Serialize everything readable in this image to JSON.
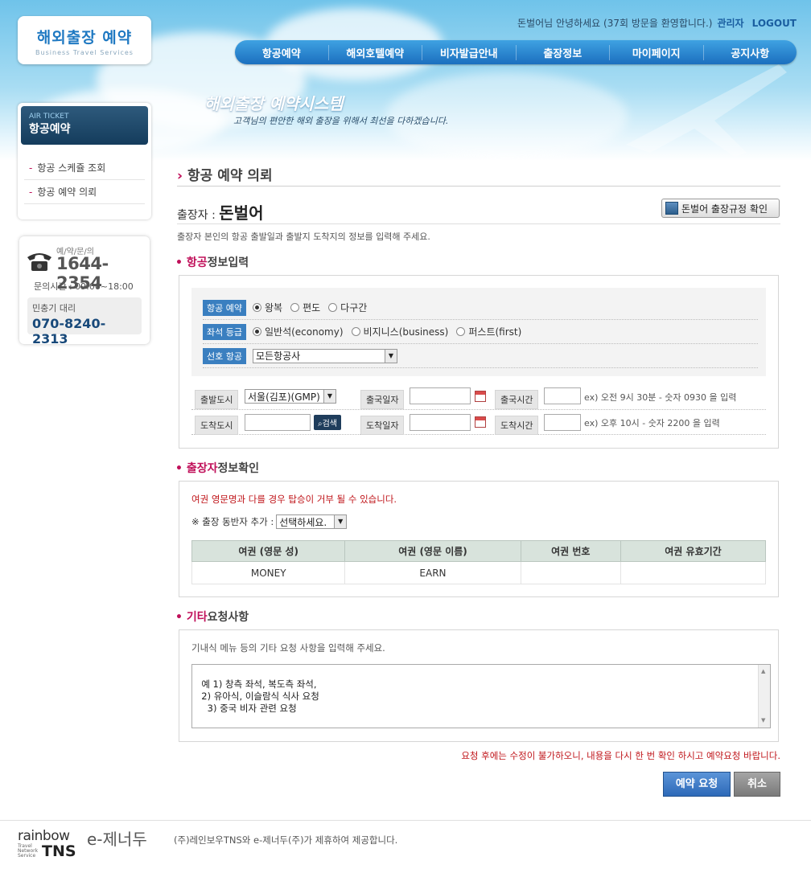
{
  "header": {
    "logo_title": "해외출장 예약",
    "logo_sub": "Business Travel Services",
    "greeting": "돈벌어님 안녕하세요 (37회 방문을 환영합니다.)",
    "admin_link": "관리자",
    "logout_link": "LOGOUT",
    "nav": [
      "항공예약",
      "해외호텔예약",
      "비자발급안내",
      "출장정보",
      "마이페이지",
      "공지사항"
    ],
    "hero_title": "해외출장 예약시스템",
    "hero_sub": "고객님의 편안한 해외 출장을 위해서 최선을 다하겠습니다."
  },
  "sidebar": {
    "head_en": "AIR TICKET",
    "head_ko": "항공예약",
    "items": [
      "항공 스케쥴 조회",
      "항공 예약 의뢰"
    ]
  },
  "contact": {
    "label": "예/약/문/의",
    "phone": "1644-2354",
    "hours": "문의시간 : 09:00~18:00",
    "agent_label": "민충기 대리",
    "agent_phone": "070-8240-2313"
  },
  "main": {
    "page_title": "항공 예약 의뢰",
    "traveler_label": "출장자 :",
    "traveler_name": "돈벌어",
    "rule_button": "돈벌어 출장규정 확인",
    "description": "출장자 본인의 항공 출발일과 출발지 도착지의 정보를 입력해 주세요."
  },
  "flight": {
    "section_em": "항공",
    "section_rest": "정보입력",
    "booking_label": "항공 예약",
    "booking_options": [
      "왕복",
      "편도",
      "다구간"
    ],
    "booking_selected": "왕복",
    "seat_label": "좌석 등급",
    "seat_options": [
      "일반석(economy)",
      "비지니스(business)",
      "퍼스트(first)"
    ],
    "seat_selected": "일반석(economy)",
    "airline_label": "선호 항공",
    "airline_value": "모든항공사",
    "depart_city_label": "출발도시",
    "depart_city_value": "서울(김포)(GMP)",
    "depart_date_label": "출국일자",
    "depart_time_label": "출국시간",
    "depart_hint": "ex) 오전 9시 30분 - 숫자 0930 을 입력",
    "arrive_city_label": "도착도시",
    "search_button": "검색",
    "arrive_date_label": "도착일자",
    "arrive_time_label": "도착시간",
    "arrive_hint": "ex) 오후 10시 - 숫자 2200 을 입력"
  },
  "traveler_info": {
    "section_em": "출장자",
    "section_rest": "정보확인",
    "warning": "여권 영문명과 다를 경우 탑승이 거부 될 수 있습니다.",
    "companion_label": "※ 출장 동반자 추가 :",
    "companion_value": "선택하세요.",
    "columns": [
      "여권 (영문 성)",
      "여권 (영문 이름)",
      "여권 번호",
      "여권 유효기간"
    ],
    "rows": [
      [
        "MONEY",
        "EARN",
        "",
        ""
      ]
    ]
  },
  "other": {
    "section_em": "기타",
    "section_rest": "요청사항",
    "guide": "기내식 메뉴 등의 기타 요청 사항을 입력해 주세요.",
    "textarea_value": "예 1) 창측 좌석, 복도측 좌석,\n  2) 유아식, 이슬람식 식사 요청\n    3) 중국 비자 관련 요청"
  },
  "actions": {
    "warning": "요청 후에는 수정이 불가하오니, 내용을 다시 한 번 확인 하시고 예약요청 바랍니다.",
    "submit": "예약 요청",
    "cancel": "취소"
  },
  "footer": {
    "rainbow": "rainbow",
    "tns": "TNS",
    "tns_small": "Travel\nNetwork\nService",
    "ezenerdu": "e-제너두",
    "text": "(주)레인보우TNS와 e-제너두(주)가 제휴하여 제공합니다."
  }
}
